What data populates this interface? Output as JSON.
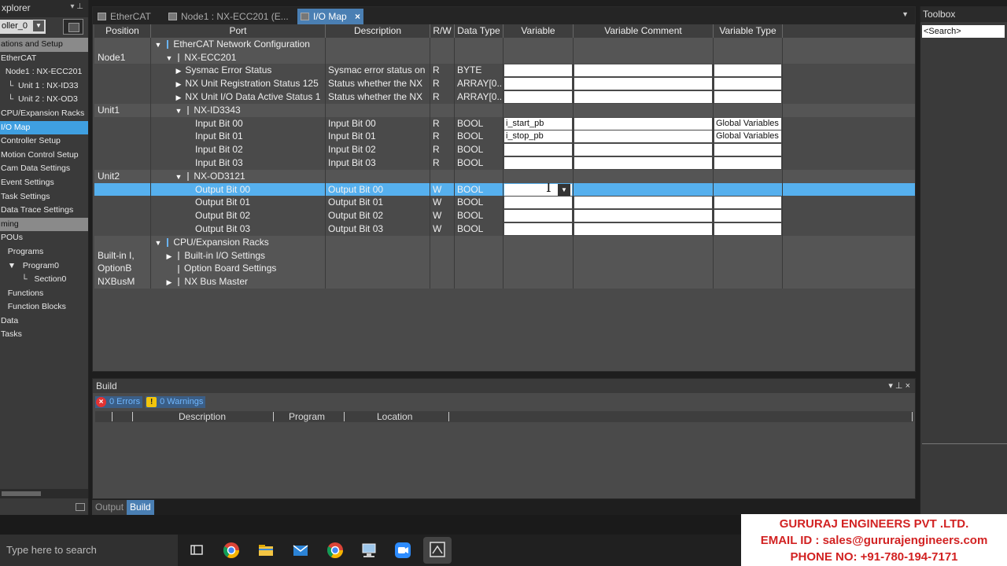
{
  "explorer": {
    "title": "xplorer",
    "controller": "oller_0",
    "items": [
      {
        "label": "ations and Setup",
        "kind": "hdr"
      },
      {
        "label": "EtherCAT",
        "kind": ""
      },
      {
        "label": "  Node1 : NX-ECC201",
        "kind": ""
      },
      {
        "label": "   └  Unit 1 : NX-ID33",
        "kind": ""
      },
      {
        "label": "   └  Unit 2 : NX-OD3",
        "kind": ""
      },
      {
        "label": "CPU/Expansion Racks",
        "kind": ""
      },
      {
        "label": "I/O Map",
        "kind": "sel"
      },
      {
        "label": "Controller Setup",
        "kind": ""
      },
      {
        "label": "Motion Control Setup",
        "kind": ""
      },
      {
        "label": "Cam Data Settings",
        "kind": ""
      },
      {
        "label": "Event Settings",
        "kind": ""
      },
      {
        "label": "Task Settings",
        "kind": ""
      },
      {
        "label": "Data Trace Settings",
        "kind": ""
      },
      {
        "label": "ming",
        "kind": "hdr"
      },
      {
        "label": "POUs",
        "kind": ""
      },
      {
        "label": "   Programs",
        "kind": ""
      },
      {
        "label": "   ▼   Program0",
        "kind": ""
      },
      {
        "label": "         └   Section0",
        "kind": ""
      },
      {
        "label": "   Functions",
        "kind": ""
      },
      {
        "label": "   Function Blocks",
        "kind": ""
      },
      {
        "label": "Data",
        "kind": ""
      },
      {
        "label": "Tasks",
        "kind": ""
      }
    ]
  },
  "tabs": [
    {
      "label": "EtherCAT",
      "active": false
    },
    {
      "label": "Node1 : NX-ECC201 (E...",
      "active": false
    },
    {
      "label": "I/O Map",
      "active": true
    }
  ],
  "columns": [
    "Position",
    "Port",
    "Description",
    "R/W",
    "Data Type",
    "Variable",
    "Variable Comment",
    "Variable Type"
  ],
  "rows": [
    {
      "pos": "",
      "caret": "▼",
      "icon": "blue",
      "port": "EtherCAT Network Configuration",
      "indent": 0,
      "desc": "",
      "rw": "",
      "dt": "",
      "var": "",
      "vtype": "",
      "boxes": false,
      "band": true
    },
    {
      "pos": "Node1",
      "caret": "▼",
      "icon": "gray",
      "port": "NX-ECC201",
      "indent": 1,
      "desc": "",
      "rw": "",
      "dt": "",
      "var": "",
      "vtype": "",
      "boxes": false,
      "band": true
    },
    {
      "pos": "",
      "caret": "▶",
      "icon": "",
      "port": "Sysmac Error Status",
      "indent": 2,
      "desc": "Sysmac error status on",
      "rw": "R",
      "dt": "BYTE",
      "var": "",
      "vtype": "",
      "boxes": true,
      "band": false
    },
    {
      "pos": "",
      "caret": "▶",
      "icon": "",
      "port": "NX Unit Registration Status 125",
      "indent": 2,
      "desc": "Status whether the NX",
      "rw": "R",
      "dt": "ARRAY[0..1",
      "var": "",
      "vtype": "",
      "boxes": true,
      "band": false
    },
    {
      "pos": "",
      "caret": "▶",
      "icon": "",
      "port": "NX Unit I/O Data Active Status 1",
      "indent": 2,
      "desc": "Status whether the NX",
      "rw": "R",
      "dt": "ARRAY[0..1",
      "var": "",
      "vtype": "",
      "boxes": true,
      "band": false
    },
    {
      "pos": "Unit1",
      "caret": "▼",
      "icon": "gray",
      "port": "NX-ID3343",
      "indent": 2,
      "desc": "",
      "rw": "",
      "dt": "",
      "var": "",
      "vtype": "",
      "boxes": false,
      "band": true
    },
    {
      "pos": "",
      "caret": "",
      "icon": "",
      "port": "Input Bit 00",
      "indent": 3,
      "desc": "Input Bit 00",
      "rw": "R",
      "dt": "BOOL",
      "var": "i_start_pb",
      "vtype": "Global Variables",
      "boxes": true,
      "band": false
    },
    {
      "pos": "",
      "caret": "",
      "icon": "",
      "port": "Input Bit 01",
      "indent": 3,
      "desc": "Input Bit 01",
      "rw": "R",
      "dt": "BOOL",
      "var": "i_stop_pb",
      "vtype": "Global Variables",
      "boxes": true,
      "band": false
    },
    {
      "pos": "",
      "caret": "",
      "icon": "",
      "port": "Input Bit 02",
      "indent": 3,
      "desc": "Input Bit 02",
      "rw": "R",
      "dt": "BOOL",
      "var": "",
      "vtype": "",
      "boxes": true,
      "band": false
    },
    {
      "pos": "",
      "caret": "",
      "icon": "",
      "port": "Input Bit 03",
      "indent": 3,
      "desc": "Input Bit 03",
      "rw": "R",
      "dt": "BOOL",
      "var": "",
      "vtype": "",
      "boxes": true,
      "band": false
    },
    {
      "pos": "Unit2",
      "caret": "▼",
      "icon": "gray",
      "port": "NX-OD3121",
      "indent": 2,
      "desc": "",
      "rw": "",
      "dt": "",
      "var": "",
      "vtype": "",
      "boxes": false,
      "band": true
    },
    {
      "pos": "",
      "caret": "",
      "icon": "",
      "port": "Output Bit 00",
      "indent": 3,
      "desc": "Output Bit 00",
      "rw": "W",
      "dt": "BOOL",
      "var": "",
      "vtype": "",
      "boxes": false,
      "band": false,
      "sel": true
    },
    {
      "pos": "",
      "caret": "",
      "icon": "",
      "port": "Output Bit 01",
      "indent": 3,
      "desc": "Output Bit 01",
      "rw": "W",
      "dt": "BOOL",
      "var": "",
      "vtype": "",
      "boxes": true,
      "band": false
    },
    {
      "pos": "",
      "caret": "",
      "icon": "",
      "port": "Output Bit 02",
      "indent": 3,
      "desc": "Output Bit 02",
      "rw": "W",
      "dt": "BOOL",
      "var": "",
      "vtype": "",
      "boxes": true,
      "band": false
    },
    {
      "pos": "",
      "caret": "",
      "icon": "",
      "port": "Output Bit 03",
      "indent": 3,
      "desc": "Output Bit 03",
      "rw": "W",
      "dt": "BOOL",
      "var": "",
      "vtype": "",
      "boxes": true,
      "band": false
    },
    {
      "pos": "",
      "caret": "▼",
      "icon": "blue",
      "port": "CPU/Expansion Racks",
      "indent": 0,
      "desc": "",
      "rw": "",
      "dt": "",
      "var": "",
      "vtype": "",
      "boxes": false,
      "band": true
    },
    {
      "pos": "Built-in I,",
      "caret": "▶",
      "icon": "gray",
      "port": "Built-in I/O Settings",
      "indent": 1,
      "desc": "",
      "rw": "",
      "dt": "",
      "var": "",
      "vtype": "",
      "boxes": false,
      "band": true
    },
    {
      "pos": "OptionB",
      "caret": "",
      "icon": "gray",
      "port": "Option Board Settings",
      "indent": 1,
      "desc": "",
      "rw": "",
      "dt": "",
      "var": "",
      "vtype": "",
      "boxes": false,
      "band": true
    },
    {
      "pos": "NXBusM",
      "caret": "▶",
      "icon": "gray",
      "port": "NX Bus Master",
      "indent": 1,
      "desc": "",
      "rw": "",
      "dt": "",
      "var": "",
      "vtype": "",
      "boxes": false,
      "band": true
    }
  ],
  "build": {
    "title": "Build",
    "errors": "0 Errors",
    "warnings": "0 Warnings",
    "col_description": "Description",
    "col_program": "Program",
    "col_location": "Location",
    "tab_output": "Output",
    "tab_build": "Build"
  },
  "toolbox": {
    "title": "Toolbox",
    "search_value": "<Search>"
  },
  "taskbar": {
    "search_placeholder": "Type here to search"
  },
  "banner": {
    "company": "GURURAJ ENGINEERS PVT .LTD.",
    "email": "EMAIL ID : sales@gururajengineers.com",
    "phone": "PHONE NO: +91-780-194-7171"
  }
}
